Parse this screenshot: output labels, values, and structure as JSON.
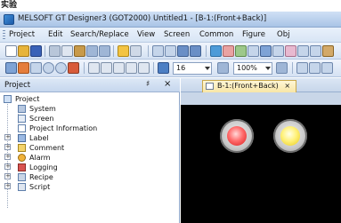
{
  "caption": "实验",
  "window": {
    "title": "MELSOFT GT Designer3 (GOT2000) Untitled1 - [B-1:(Front+Back)]"
  },
  "menu": {
    "items": [
      "Project",
      "Edit",
      "Search/Replace",
      "View",
      "Screen",
      "Common",
      "Figure",
      "Obj"
    ]
  },
  "toolbar2": {
    "line_width_value": "16",
    "zoom_value": "100%"
  },
  "project_panel": {
    "title": "Project",
    "pin_icon": "pin-icon",
    "close_label": "×",
    "tree": [
      {
        "label": "Project",
        "icon": "project-icon"
      },
      {
        "label": "System",
        "icon": "system-icon"
      },
      {
        "label": "Screen",
        "icon": "screen-icon"
      },
      {
        "label": "Project Information",
        "icon": "info-icon"
      },
      {
        "label": "Label",
        "icon": "label-icon"
      },
      {
        "label": "Comment",
        "icon": "comment-icon"
      },
      {
        "label": "Alarm",
        "icon": "alarm-icon"
      },
      {
        "label": "Logging",
        "icon": "logging-icon"
      },
      {
        "label": "Recipe",
        "icon": "recipe-icon"
      },
      {
        "label": "Script",
        "icon": "script-icon"
      }
    ]
  },
  "editor": {
    "tab_label": "B-1:(Front+Back)",
    "tab_close": "×",
    "lamps": [
      {
        "color": "red",
        "hex": "#e83a3a"
      },
      {
        "color": "yellow",
        "hex": "#f2e04a"
      }
    ]
  }
}
